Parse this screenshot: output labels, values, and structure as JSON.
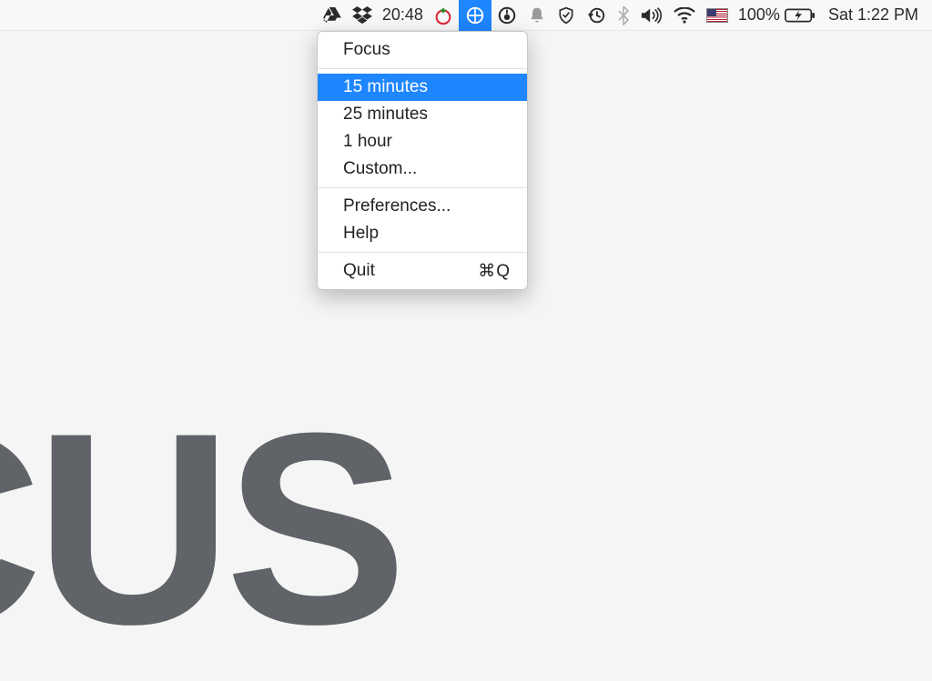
{
  "menubar": {
    "timer_text": "20:48",
    "battery_percent": "100%",
    "clock": "Sat 1:22 PM"
  },
  "dropdown": {
    "title": "Focus",
    "opt_15": "15 minutes",
    "opt_25": "25 minutes",
    "opt_1h": "1 hour",
    "opt_custom": "Custom...",
    "prefs": "Preferences...",
    "help": "Help",
    "quit": "Quit",
    "quit_shortcut": "⌘Q"
  },
  "background_text": "CUS"
}
